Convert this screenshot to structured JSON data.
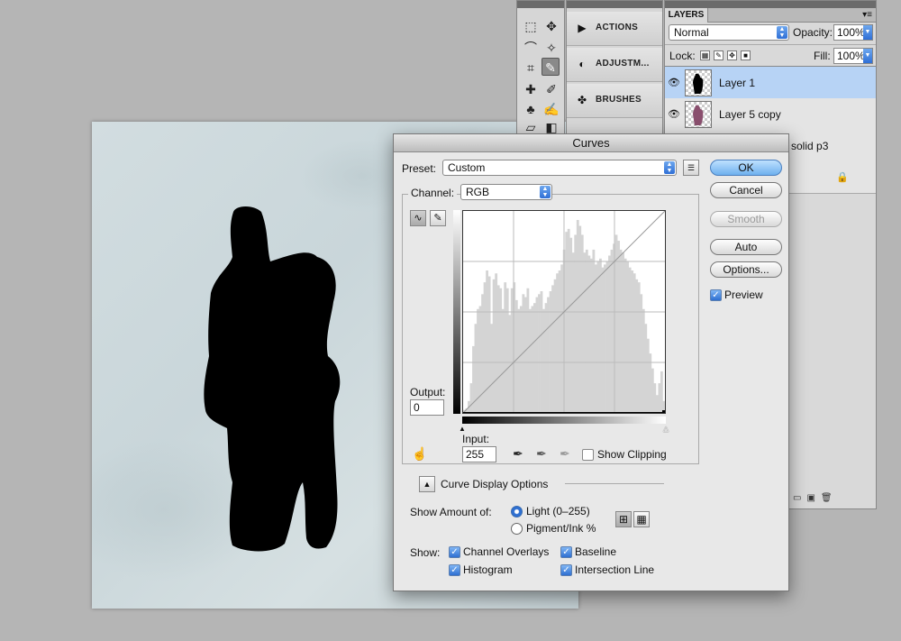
{
  "toolbox": {
    "tools": [
      "marquee-icon",
      "move-icon",
      "lasso-icon",
      "magic-wand-icon",
      "crop-icon",
      "eyedropper-icon",
      "healing-brush-icon",
      "brush-icon",
      "clone-stamp-icon",
      "history-brush-icon",
      "eraser-icon",
      "gradient-icon"
    ]
  },
  "dock": {
    "items": [
      {
        "label": "ACTIONS",
        "icon": "play-icon"
      },
      {
        "label": "ADJUSTM...",
        "icon": "adjustments-icon"
      },
      {
        "label": "BRUSHES",
        "icon": "brushes-icon"
      }
    ]
  },
  "layers": {
    "tab_label": "LAYERS",
    "blend_mode": "Normal",
    "opacity_label": "Opacity:",
    "opacity_value": "100%",
    "lock_label": "Lock:",
    "fill_label": "Fill:",
    "fill_value": "100%",
    "items": [
      {
        "name": "Layer 1",
        "selected": true
      },
      {
        "name": "Layer 5 copy",
        "selected": false
      },
      {
        "name": "solid p3",
        "selected": false
      }
    ]
  },
  "curves": {
    "title": "Curves",
    "preset_label": "Preset:",
    "preset_value": "Custom",
    "channel_label": "Channel:",
    "channel_value": "RGB",
    "output_label": "Output:",
    "output_value": "0",
    "input_label": "Input:",
    "input_value": "255",
    "show_clipping_label": "Show Clipping",
    "show_clipping_checked": false,
    "buttons": {
      "ok": "OK",
      "cancel": "Cancel",
      "smooth": "Smooth",
      "auto": "Auto",
      "options": "Options..."
    },
    "preview_label": "Preview",
    "preview_checked": true,
    "display_options_label": "Curve Display Options",
    "show_amount_label": "Show Amount of:",
    "light_label": "Light  (0–255)",
    "pigment_label": "Pigment/Ink %",
    "light_selected": true,
    "show_label": "Show:",
    "channel_overlays_label": "Channel Overlays",
    "baseline_label": "Baseline",
    "histogram_label": "Histogram",
    "intersection_label": "Intersection Line",
    "histogram_values": [
      2,
      3,
      8,
      20,
      45,
      60,
      70,
      72,
      80,
      88,
      96,
      92,
      60,
      90,
      94,
      86,
      84,
      70,
      88,
      84,
      66,
      84,
      88,
      76,
      70,
      72,
      80,
      78,
      84,
      70,
      72,
      74,
      78,
      80,
      82,
      70,
      74,
      78,
      82,
      86,
      90,
      94,
      96,
      100,
      110,
      122,
      124,
      118,
      108,
      120,
      130,
      126,
      120,
      108,
      110,
      106,
      104,
      110,
      100,
      102,
      104,
      98,
      100,
      102,
      106,
      110,
      114,
      120,
      116,
      110,
      108,
      104,
      102,
      98,
      96,
      94,
      90,
      88,
      80,
      70,
      60,
      50,
      40,
      30,
      20,
      12,
      20,
      28,
      8
    ]
  }
}
